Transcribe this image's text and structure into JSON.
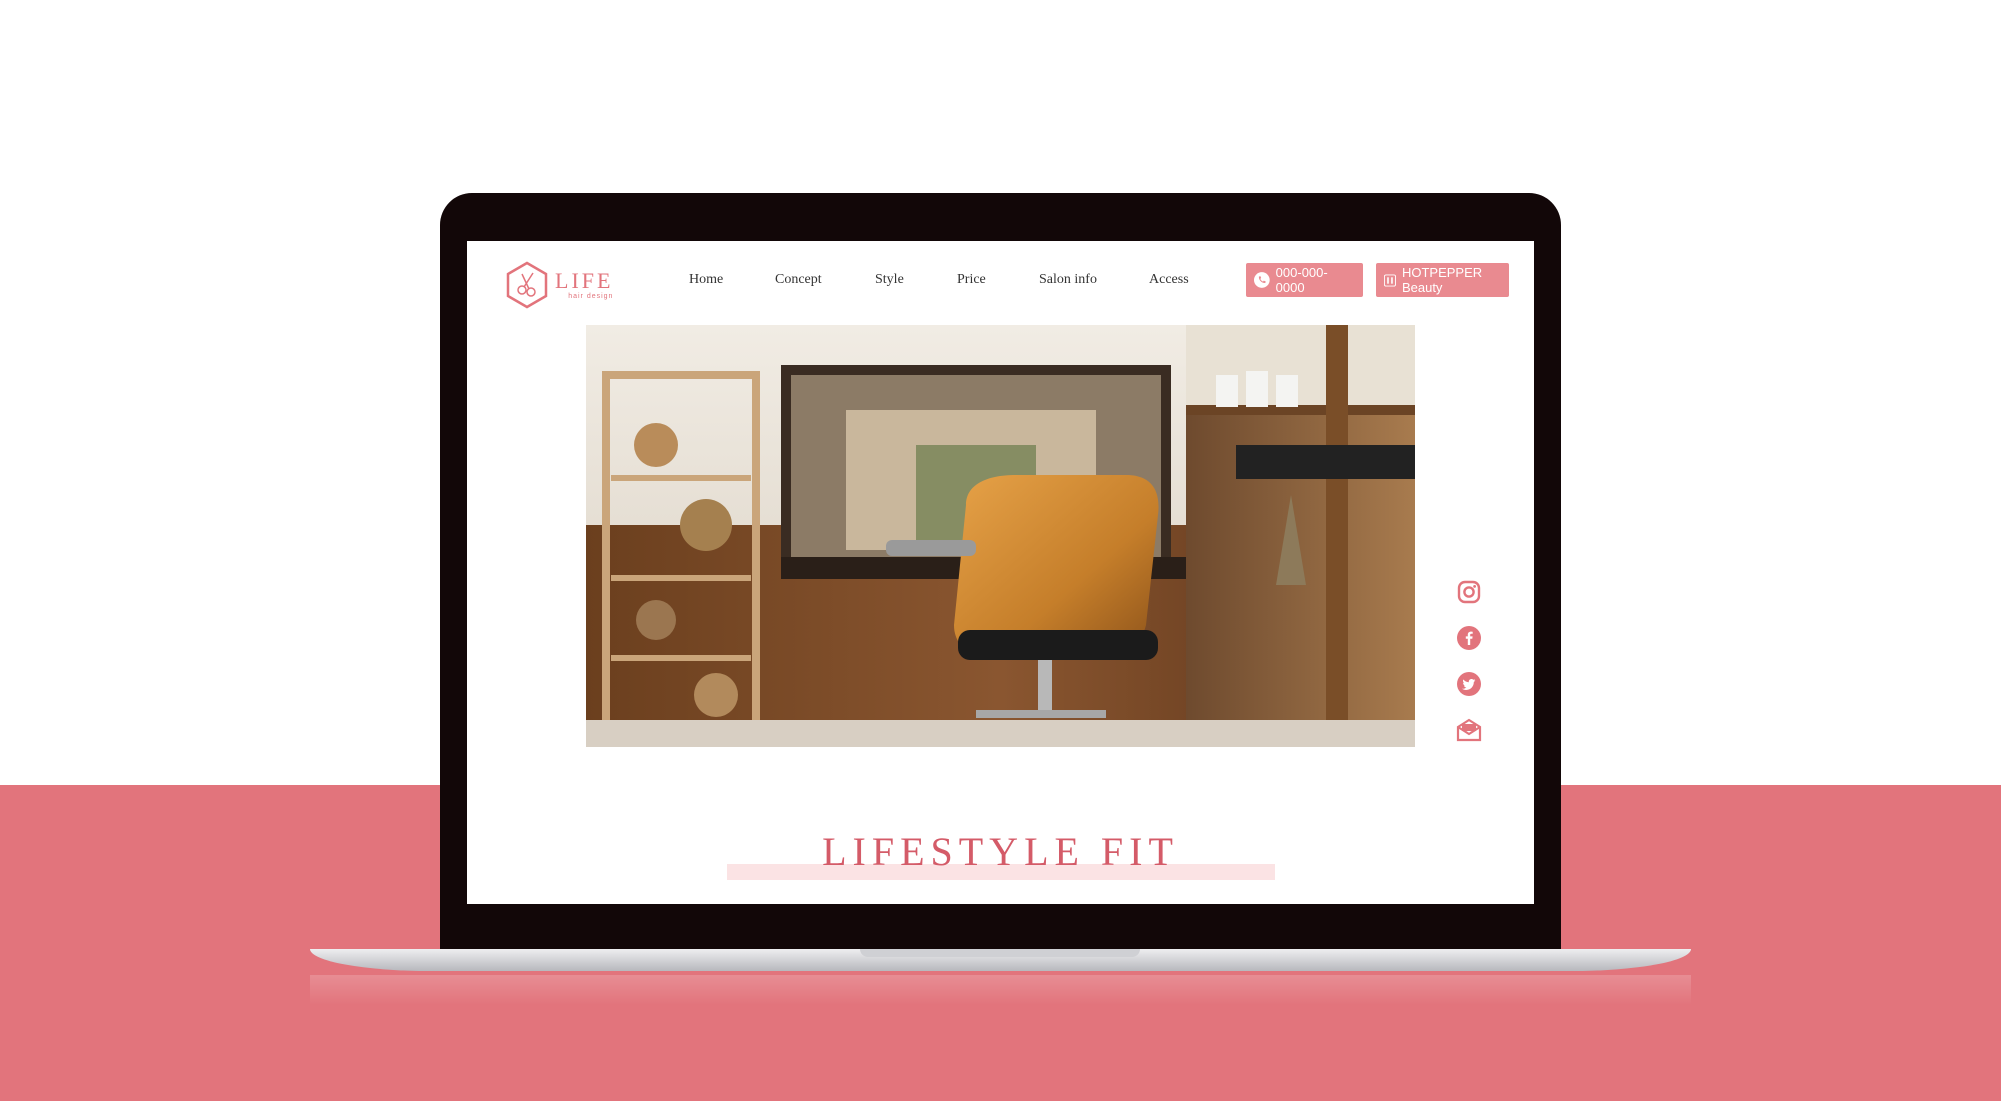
{
  "colors": {
    "accent": "#e2747c",
    "button": "#e98a90",
    "tagline": "#d45b68",
    "highlight": "#fbe3e4",
    "laptop_bezel": "#120708"
  },
  "header": {
    "logo": {
      "title": "LIFE",
      "subtitle": "hair design",
      "icon": "scissors-hexagon-icon"
    },
    "nav": [
      "Home",
      "Concept",
      "Style",
      "Price",
      "Salon info",
      "Access"
    ],
    "phone_button": {
      "label": "000-000-0000",
      "icon": "phone-icon"
    },
    "hotpepper_button": {
      "label": "HOTPEPPER Beauty",
      "icon": "hotpepper-icon"
    }
  },
  "hero": {
    "image": "salon-interior-photo"
  },
  "social": [
    "instagram-icon",
    "facebook-icon",
    "twitter-icon",
    "mail-icon"
  ],
  "main": {
    "tagline": "LIFESTYLE FIT"
  }
}
